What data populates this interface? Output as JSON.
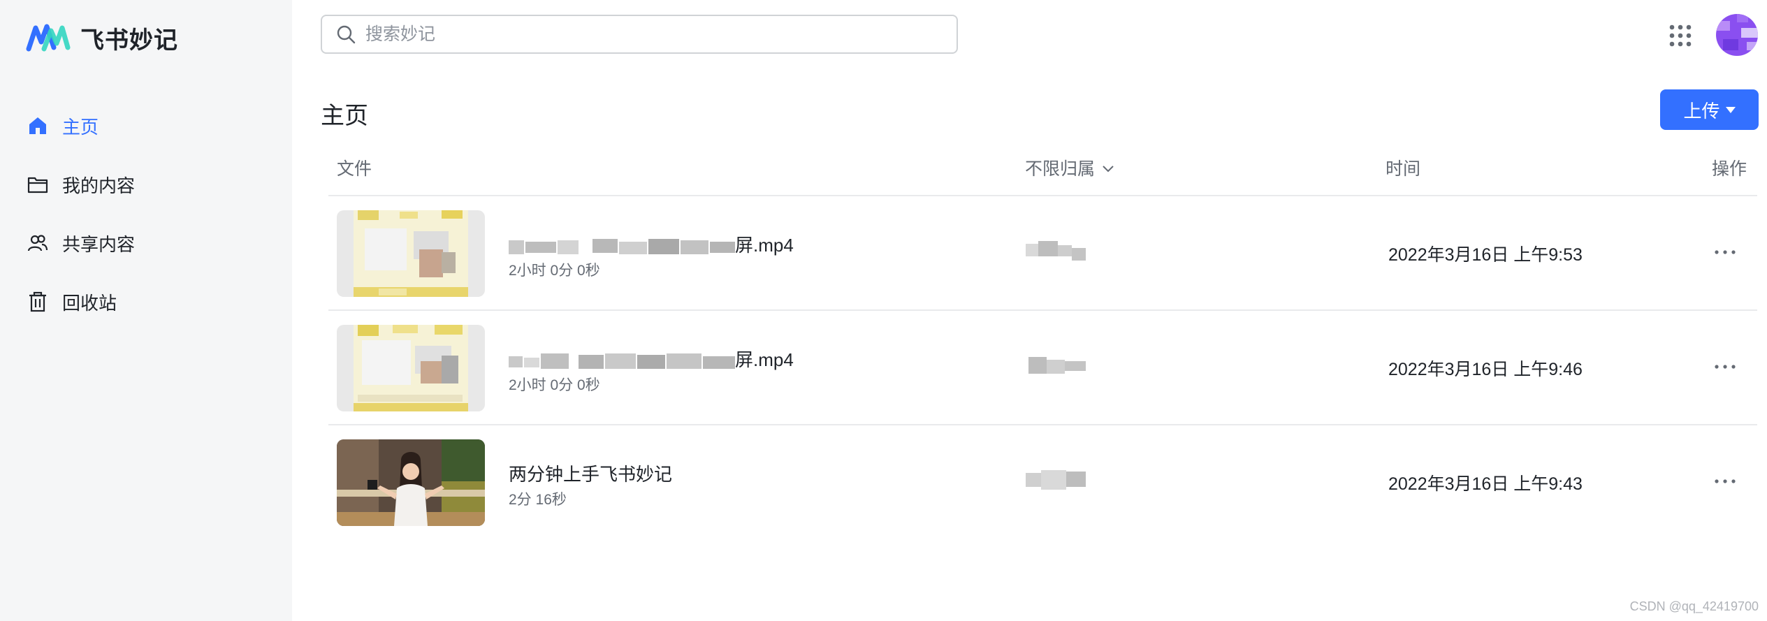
{
  "app": {
    "name": "飞书妙记",
    "brand_colors": [
      "#3370ff",
      "#33d6c0",
      "#5b8cff"
    ]
  },
  "sidebar": {
    "items": [
      {
        "label": "主页",
        "icon": "home-icon",
        "active": true
      },
      {
        "label": "我的内容",
        "icon": "folder-icon",
        "active": false
      },
      {
        "label": "共享内容",
        "icon": "users-icon",
        "active": false
      },
      {
        "label": "回收站",
        "icon": "trash-icon",
        "active": false
      }
    ]
  },
  "search": {
    "placeholder": "搜索妙记",
    "value": ""
  },
  "header": {
    "apps_icon": "grid-apps-icon",
    "avatar_icon": "avatar"
  },
  "main": {
    "title": "主页",
    "upload_label": "上传",
    "columns": {
      "file": "文件",
      "owner": "不限归属",
      "time": "时间",
      "ops": "操作"
    },
    "rows": [
      {
        "name_suffix": "屏.mp4",
        "duration": "2小时 0分 0秒",
        "time": "2022年3月16日 上午9:53"
      },
      {
        "name_suffix": "屏.mp4",
        "duration": "2小时 0分 0秒",
        "time": "2022年3月16日 上午9:46"
      },
      {
        "name_suffix": "两分钟上手飞书妙记",
        "duration": "2分 16秒",
        "time": "2022年3月16日 上午9:43"
      }
    ]
  },
  "colors": {
    "accent": "#3370ff",
    "sidebar_bg": "#f5f6f7",
    "border": "#e9eaec",
    "muted_text": "#646a73"
  },
  "watermark": "CSDN @qq_42419700"
}
